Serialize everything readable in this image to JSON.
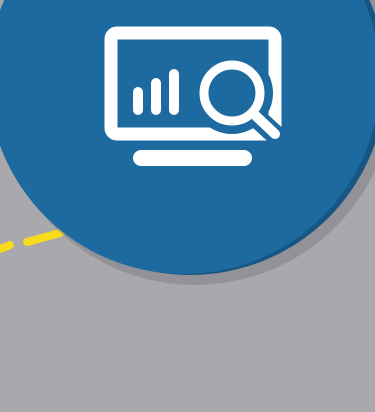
{
  "graphic": {
    "icon": "monitor-analytics-search-icon",
    "colors": {
      "background": "#a9a9ad",
      "circle": "#1c6a9f",
      "circle_shadow": "#175582",
      "drop_shadow": "#7f8086",
      "dashes": "#f6dc1b",
      "icon": "#ffffff"
    }
  }
}
